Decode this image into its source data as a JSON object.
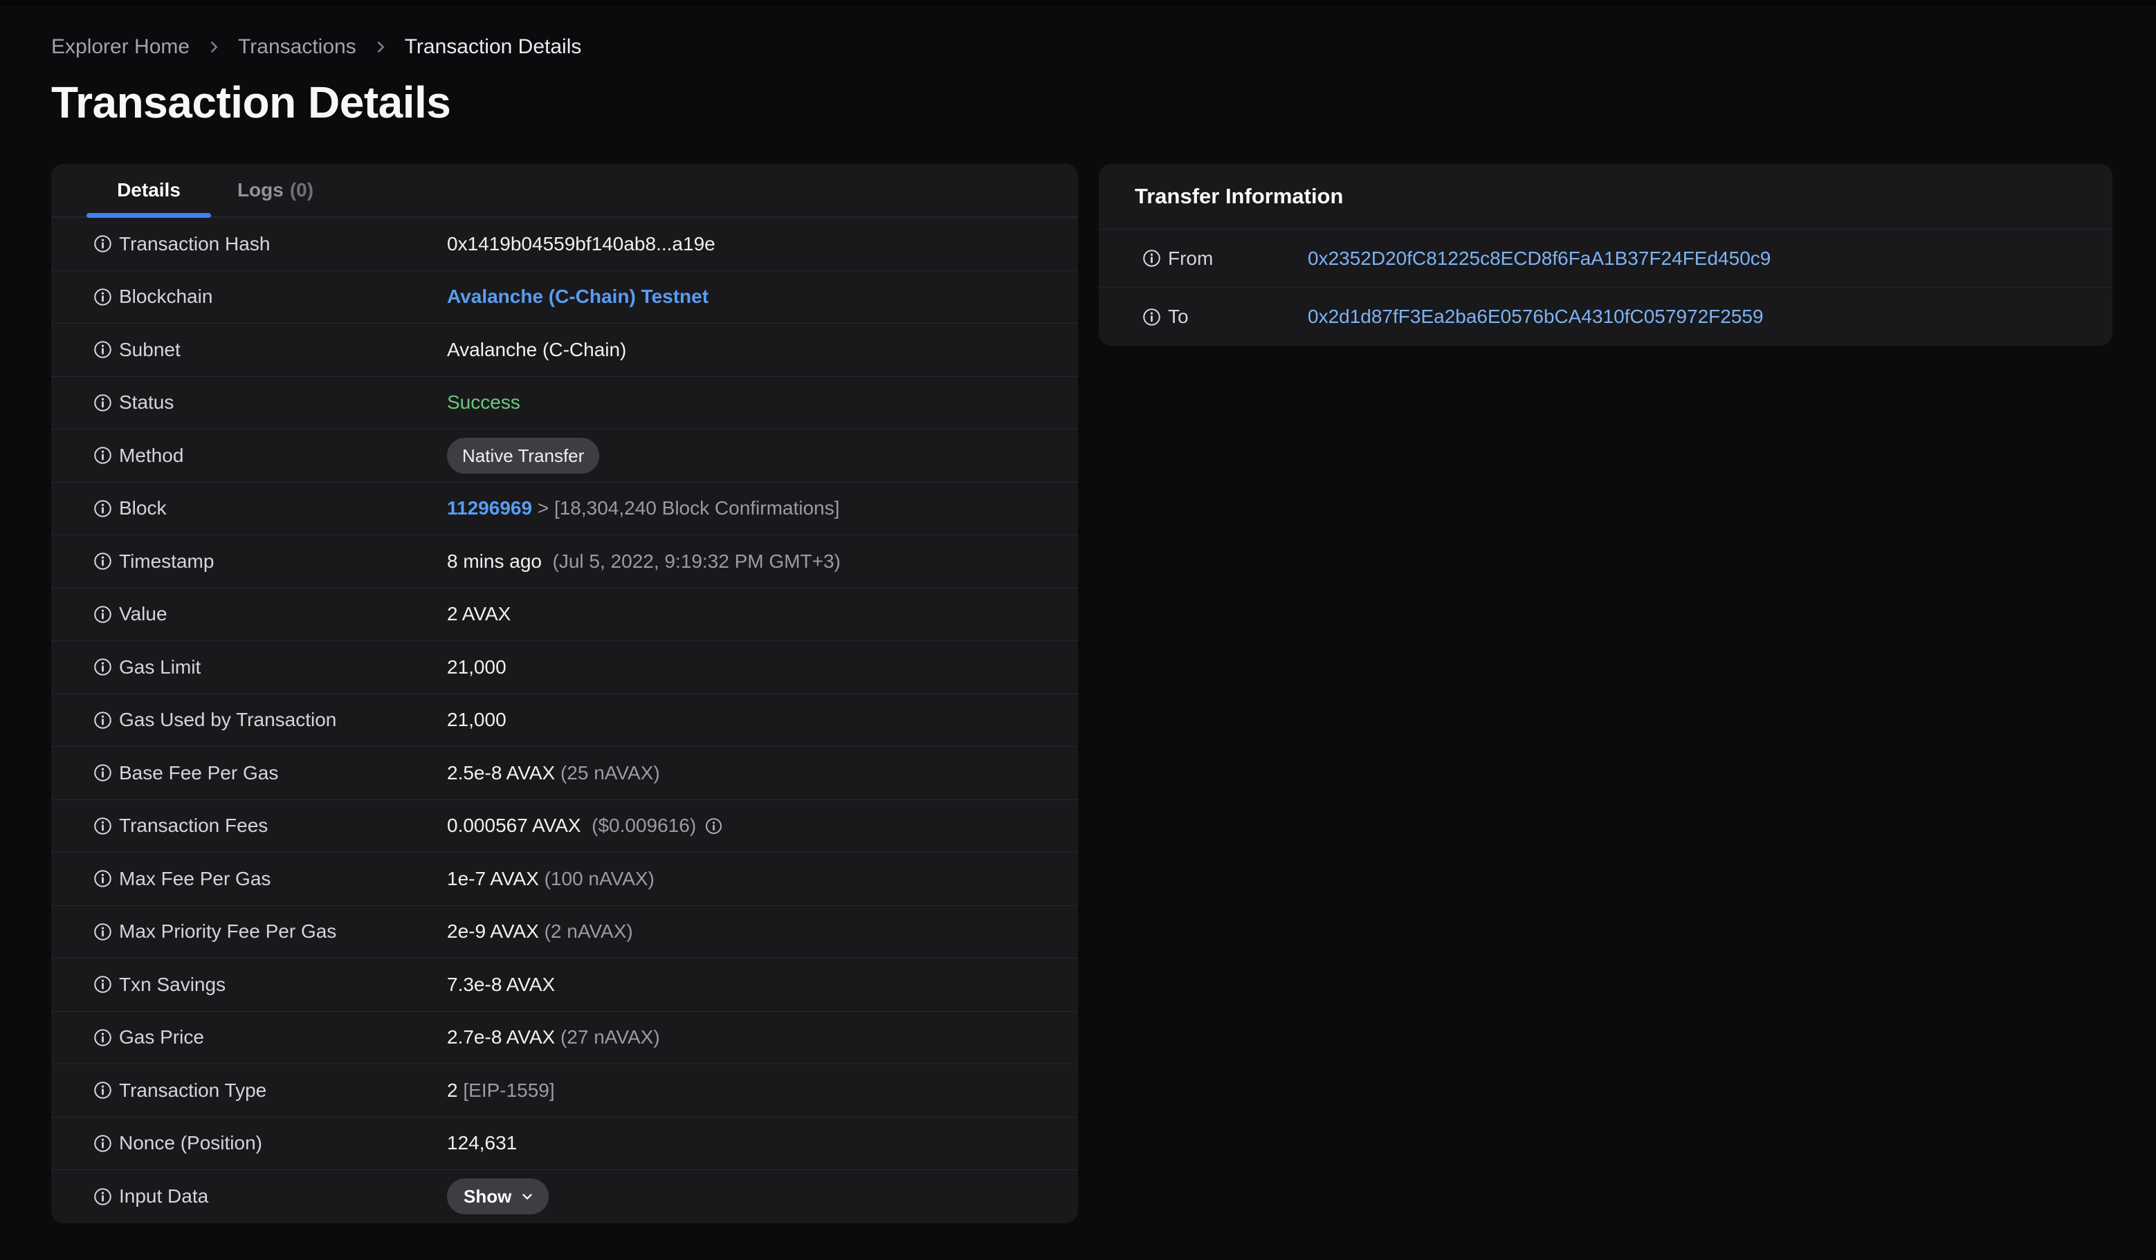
{
  "colors": {
    "background": "#0b0b0d",
    "card": "#19191c",
    "divider": "#27272c",
    "accent_blue": "#3e82f2",
    "link_blue": "#5a9cf4",
    "address_blue": "#7fb2f4",
    "success_green": "#6cca7c",
    "primary_text": "#f1f1f3",
    "muted_text": "#9b9ba3"
  },
  "breadcrumb": {
    "items": [
      "Explorer Home",
      "Transactions",
      "Transaction Details"
    ]
  },
  "page": {
    "title": "Transaction Details"
  },
  "details_card": {
    "tabs": [
      {
        "label": "Details",
        "active": true
      },
      {
        "label": "Logs",
        "count": "(0)",
        "active": false
      }
    ],
    "rows": [
      {
        "label": "Transaction Hash",
        "value_parts": [
          {
            "text": "0x1419b04559bf140ab8...a19e",
            "style": "primary"
          }
        ]
      },
      {
        "label": "Blockchain",
        "value_parts": [
          {
            "text": "Avalanche (C-Chain) Testnet",
            "style": "link"
          }
        ]
      },
      {
        "label": "Subnet",
        "value_parts": [
          {
            "text": "Avalanche (C-Chain)",
            "style": "primary"
          }
        ]
      },
      {
        "label": "Status",
        "value_parts": [
          {
            "text": "Success",
            "style": "success"
          }
        ]
      },
      {
        "label": "Method",
        "value_parts": [
          {
            "text": "Native Transfer",
            "style": "badge"
          }
        ]
      },
      {
        "label": "Block",
        "value_parts": [
          {
            "text": "11296969",
            "style": "link"
          },
          {
            "text": " > [18,304,240 Block Confirmations]",
            "style": "muted"
          }
        ]
      },
      {
        "label": "Timestamp",
        "value_parts": [
          {
            "text": "8 mins ago",
            "style": "primary"
          },
          {
            "text": "  (Jul 5, 2022, 9:19:32 PM GMT+3)",
            "style": "muted"
          }
        ]
      },
      {
        "label": "Value",
        "value_parts": [
          {
            "text": "2 AVAX",
            "style": "primary"
          }
        ]
      },
      {
        "label": "Gas Limit",
        "value_parts": [
          {
            "text": "21,000",
            "style": "primary"
          }
        ]
      },
      {
        "label": "Gas Used by Transaction",
        "value_parts": [
          {
            "text": "21,000",
            "style": "primary"
          }
        ]
      },
      {
        "label": "Base Fee Per Gas",
        "value_parts": [
          {
            "text": "2.5e-8 AVAX",
            "style": "primary"
          },
          {
            "text": " (25 nAVAX)",
            "style": "muted"
          }
        ]
      },
      {
        "label": "Transaction Fees",
        "value_parts": [
          {
            "text": "0.000567 AVAX",
            "style": "primary"
          },
          {
            "text": "  ($0.009616)",
            "style": "muted"
          }
        ],
        "trailing_icon": "info-icon"
      },
      {
        "label": "Max Fee Per Gas",
        "value_parts": [
          {
            "text": "1e-7 AVAX",
            "style": "primary"
          },
          {
            "text": " (100 nAVAX)",
            "style": "muted"
          }
        ]
      },
      {
        "label": "Max Priority Fee Per Gas",
        "value_parts": [
          {
            "text": "2e-9 AVAX",
            "style": "primary"
          },
          {
            "text": " (2 nAVAX)",
            "style": "muted"
          }
        ]
      },
      {
        "label": "Txn Savings",
        "value_parts": [
          {
            "text": "7.3e-8 AVAX",
            "style": "primary"
          }
        ]
      },
      {
        "label": "Gas Price",
        "value_parts": [
          {
            "text": "2.7e-8 AVAX",
            "style": "primary"
          },
          {
            "text": " (27 nAVAX)",
            "style": "muted"
          }
        ]
      },
      {
        "label": "Transaction Type",
        "value_parts": [
          {
            "text": "2",
            "style": "primary"
          },
          {
            "text": " [EIP-1559]",
            "style": "muted"
          }
        ]
      },
      {
        "label": "Nonce (Position)",
        "value_parts": [
          {
            "text": "124,631",
            "style": "primary"
          }
        ]
      },
      {
        "label": "Input Data",
        "value_parts": [
          {
            "text": "Show",
            "style": "button"
          }
        ]
      }
    ]
  },
  "transfer_card": {
    "title": "Transfer Information",
    "rows": [
      {
        "label": "From",
        "value": "0x2352D20fC81225c8ECD8f6FaA1B37F24FEd450c9"
      },
      {
        "label": "To",
        "value": "0x2d1d87fF3Ea2ba6E0576bCA4310fC057972F2559"
      }
    ]
  }
}
